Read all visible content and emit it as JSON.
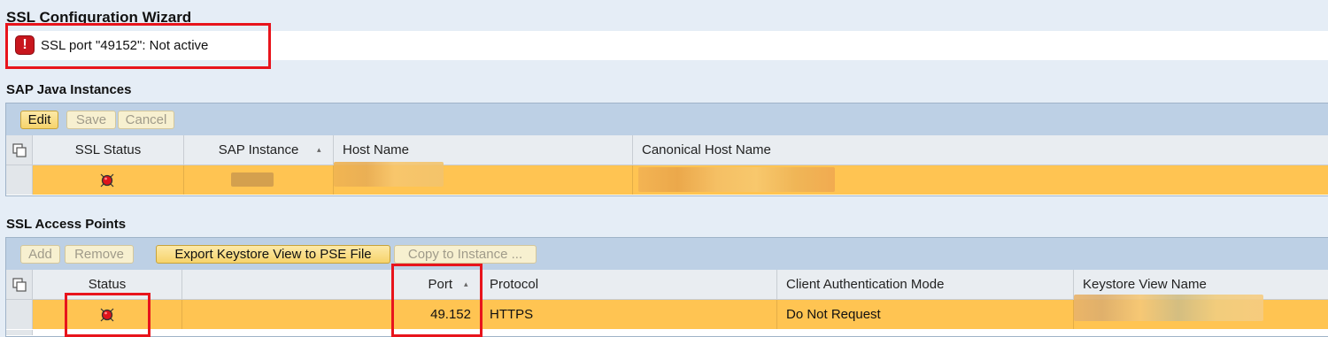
{
  "page": {
    "title": "SSL Configuration Wizard"
  },
  "message": {
    "icon": "error-icon",
    "icon_glyph": "!",
    "text": "SSL port \"49152\": Not active",
    "icon_color": "#c8161d"
  },
  "java_instances": {
    "title": "SAP Java Instances",
    "toolbar": {
      "edit_label": "Edit",
      "save_label": "Save",
      "cancel_label": "Cancel"
    },
    "columns": {
      "ssl_status": "SSL Status",
      "sap_instance": "SAP Instance",
      "host_name": "Host Name",
      "canonical_host_name": "Canonical Host Name"
    },
    "rows": [
      {
        "ssl_status": "red-status-light-icon"
      }
    ]
  },
  "access_points": {
    "title": "SSL Access Points",
    "toolbar": {
      "add_label": "Add",
      "remove_label": "Remove",
      "export_label": "Export Keystore View to PSE File",
      "copy_label": "Copy to Instance ..."
    },
    "columns": {
      "status": "Status",
      "port": "Port",
      "protocol": "Protocol",
      "client_auth": "Client Authentication Mode",
      "keystore_view": "Keystore View Name"
    },
    "rows": [
      {
        "status": "red-status-light-icon",
        "port": "49.152",
        "protocol": "HTTPS",
        "client_auth": "Do Not Request"
      }
    ]
  },
  "colors": {
    "selected_row": "#ffc452",
    "toolbar": "#bdd0e5",
    "annotation": "#e8141c",
    "background": "#e5edf6"
  }
}
